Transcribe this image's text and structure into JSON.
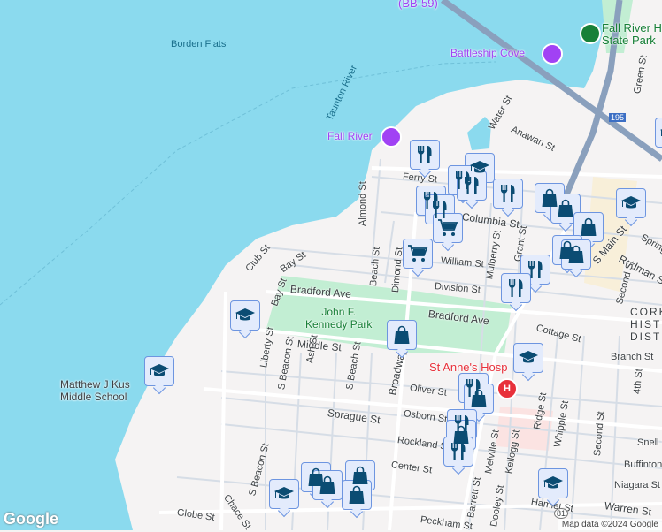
{
  "colors": {
    "water": "#8bdaee",
    "land": "#f5f3f3",
    "park": "#c2eed3",
    "road": "#ffffff",
    "highway": "#8aa0bd",
    "marker_fill": "#e3ebfc",
    "marker_border": "#6d95e0",
    "icon": "#0b4c73",
    "hospital": "#e8313b",
    "poi": "#a142f4",
    "park_text": "#188038"
  },
  "labels": {
    "bb59": "(BB-59)",
    "borden_flats": "Borden Flats",
    "taunton_river": "Taunton River",
    "battleship_cove": "Battleship Cove",
    "fall_river_park": "Fall River Heritage State Park",
    "fall_river_park_l1": "Fall River H",
    "fall_river_park_l2": "State Park",
    "fall_river": "Fall River",
    "water_st": "Water St",
    "anawan_st": "Anawan St",
    "green_st": "Green St",
    "ferry_st": "Ferry St",
    "almond_st": "Almond St",
    "columbia_st": "Columbia St",
    "bay_st": "Bay St",
    "bay_st2": "Bay St",
    "club_st": "Club St",
    "beach_st": "Beach St",
    "dimond_st": "Dimond St",
    "william_st": "William St",
    "division_st": "Division St",
    "mulberry_st": "Mulberry St",
    "grant_st": "Grant St",
    "s_main_st": "S Main St",
    "rodman_st": "Rodman St",
    "spring_st": "Spring St",
    "second_st": "Second St",
    "second_st2": "Second St",
    "cork_district": "CORKY HISTORIC DISTRICT",
    "cork_l1": "CORK",
    "cork_l2": "HIST",
    "cork_l3": "DIST",
    "bradford_ave": "Bradford Ave",
    "bradford_ave2": "Bradford Ave",
    "jfk_park_l1": "John F.",
    "jfk_park_l2": "Kennedy Park",
    "cottage_st": "Cottage St",
    "middle_st": "Middle St",
    "branch_st": "Branch St",
    "st_annes": "St Anne's Hosp",
    "liberty_st": "Liberty St",
    "s_beacon_st": "S Beacon St",
    "s_beacon_st2": "S Beacon St",
    "ash_st": "Ash St",
    "s_beach_st": "S Beach St",
    "broadway": "Broadway",
    "oliver_st": "Oliver St",
    "osborn_st": "Osborn St",
    "sprague_st": "Sprague St",
    "rockland_st": "Rockland St",
    "center_st": "Center St",
    "melville_st": "Melville St",
    "kellogg_st": "Kellogg St",
    "ridge_st": "Ridge St",
    "whipple_st": "Whipple St",
    "fourth_st": "4th St",
    "snell_st": "Snell St",
    "buffinton_st": "Buffinton St",
    "niagara_st": "Niagara St",
    "warren_st": "Warren St",
    "hamlet_st": "Hamlet St",
    "barrett_st": "Barrett St",
    "dooley_st": "Dooley St",
    "globe_st": "Globe St",
    "chace_st": "Chace St",
    "peckham_st": "Peckham St",
    "school_l1": "Matthew J Kus",
    "school_l2": "Middle School",
    "i195": "195",
    "rt81": "81",
    "hospital_glyph": "H"
  },
  "footer": {
    "logo": "Google",
    "attribution": "Map data ©2024 Google"
  }
}
